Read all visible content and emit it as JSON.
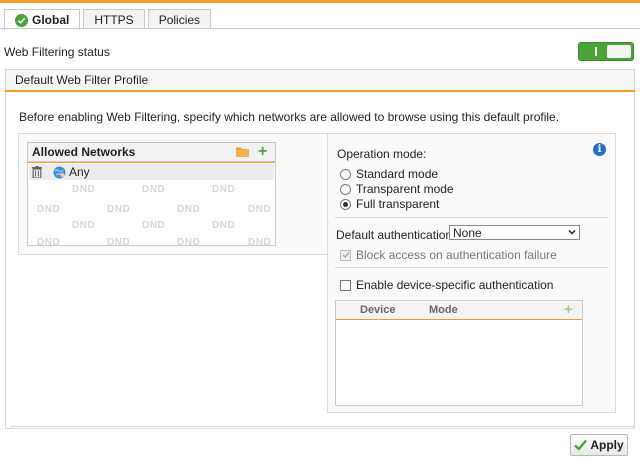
{
  "colors": {
    "accent": "#f29c2b",
    "green": "#4aa336",
    "info_blue": "#1f6fc4"
  },
  "tabs": [
    {
      "label": "Global",
      "active": true,
      "icon": "check-circle-icon"
    },
    {
      "label": "HTTPS",
      "active": false
    },
    {
      "label": "Policies",
      "active": false
    }
  ],
  "status": {
    "label": "Web Filtering status",
    "enabled": true
  },
  "profile": {
    "title": "Default Web Filter Profile",
    "intro": "Before enabling Web Filtering, specify which networks are allowed to browse using this default profile."
  },
  "networks": {
    "title": "Allowed Networks",
    "items": [
      {
        "label": "Any",
        "icon": "globe-user-icon"
      }
    ],
    "watermark": "DND"
  },
  "operation": {
    "label": "Operation mode:",
    "options": [
      {
        "label": "Standard mode",
        "checked": false
      },
      {
        "label": "Transparent mode",
        "checked": false
      },
      {
        "label": "Full transparent",
        "checked": true
      }
    ]
  },
  "auth": {
    "default_label": "Default authentication:",
    "default_value": "None",
    "block_label": "Block access on authentication failure",
    "device_label": "Enable device-specific authentication"
  },
  "device_table": {
    "columns": [
      "Device",
      "Mode"
    ]
  },
  "apply_label": "Apply"
}
